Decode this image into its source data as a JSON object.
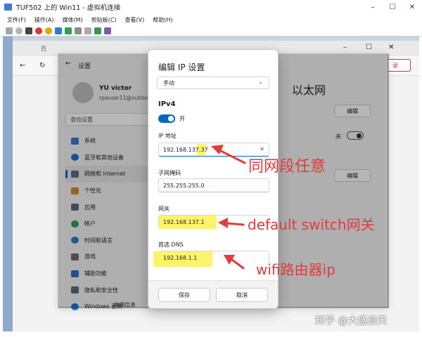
{
  "host": {
    "title": "TUF502 上的 Win11 - 虚拟机连接",
    "menu": [
      "文件(F)",
      "操作(A)",
      "媒体(M)",
      "剪贴板(C)",
      "查看(V)",
      "帮助(H)"
    ]
  },
  "browser": {
    "tab_label": "百",
    "badge_label": "录"
  },
  "settings": {
    "title": "设置",
    "user_name": "YU victor",
    "user_email": "rpauser11@outlook.com",
    "search_placeholder": "查找设置",
    "nav": [
      {
        "label": "系统",
        "icon": "monitor-icon",
        "color": "#3a7bd5"
      },
      {
        "label": "蓝牙和其他设备",
        "icon": "bluetooth-icon",
        "color": "#1f6fd1"
      },
      {
        "label": "网络和 Internet",
        "icon": "network-icon",
        "color": "#5a6e8c"
      },
      {
        "label": "个性化",
        "icon": "brush-icon",
        "color": "#d48a2c"
      },
      {
        "label": "应用",
        "icon": "apps-icon",
        "color": "#5c6b7a"
      },
      {
        "label": "帐户",
        "icon": "account-icon",
        "color": "#2e9e5a"
      },
      {
        "label": "时间和语言",
        "icon": "clock-globe-icon",
        "color": "#2f7fd0"
      },
      {
        "label": "游戏",
        "icon": "gamepad-icon",
        "color": "#6c6c6c"
      },
      {
        "label": "辅助功能",
        "icon": "accessibility-icon",
        "color": "#2b6fc9"
      },
      {
        "label": "隐私和安全性",
        "icon": "shield-icon",
        "color": "#5f6b78"
      },
      {
        "label": "Windows 更新",
        "icon": "update-icon",
        "color": "#1f6fd1"
      }
    ],
    "page_heading": "以太网",
    "edit_label": "编辑",
    "gateway_toggle_label": "关",
    "peek_bottom": "详细信息"
  },
  "dialog": {
    "title": "编辑 IP 设置",
    "mode": "手动",
    "section": "IPv4",
    "toggle_label": "开",
    "ip_label": "IP 地址",
    "ip_value": "192.168.137.37",
    "mask_label": "子网掩码",
    "mask_value": "255.255.255.0",
    "gateway_label": "网关",
    "gateway_value": "192.168.137.1",
    "dns_label": "首选 DNS",
    "dns_value": "192.168.1.1",
    "save_label": "保存",
    "cancel_label": "取消"
  },
  "annotations": {
    "ip_note": "同网段任意",
    "gateway_note": "default switch网关",
    "dns_note": "wifi路由器ip",
    "color": "#e33b3b"
  },
  "watermark": "知乎 @大盛启天"
}
